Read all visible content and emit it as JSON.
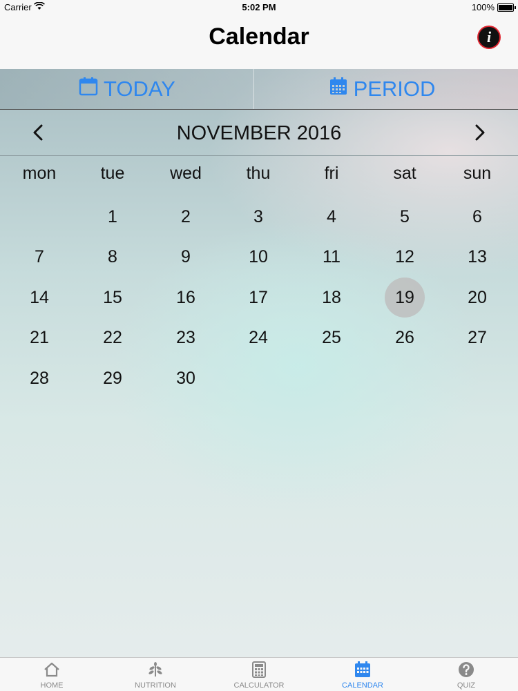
{
  "status_bar": {
    "carrier": "Carrier",
    "time": "5:02 PM",
    "battery": "100%"
  },
  "nav": {
    "title": "Calendar",
    "info_icon": "info-icon",
    "info_symbol": "i"
  },
  "segments": {
    "today": "TODAY",
    "period": "PERIOD",
    "icon": "calendar-icon"
  },
  "month": {
    "title": "NOVEMBER 2016",
    "prev_icon": "chevron-left-icon",
    "next_icon": "chevron-right-icon"
  },
  "weekdays": [
    "mon",
    "tue",
    "wed",
    "thu",
    "fri",
    "sat",
    "sun"
  ],
  "weeks": [
    [
      "",
      "1",
      "2",
      "3",
      "4",
      "5",
      "6"
    ],
    [
      "7",
      "8",
      "9",
      "10",
      "11",
      "12",
      "13"
    ],
    [
      "14",
      "15",
      "16",
      "17",
      "18",
      "19",
      "20"
    ],
    [
      "21",
      "22",
      "23",
      "24",
      "25",
      "26",
      "27"
    ],
    [
      "28",
      "29",
      "30",
      "",
      "",
      "",
      ""
    ]
  ],
  "today_date": "19",
  "colors": {
    "accent": "#2f87ee",
    "inactive": "#8a8a8a",
    "highlight": "#bebebe"
  },
  "tabs": [
    {
      "label": "HOME",
      "icon": "home-icon",
      "active": false
    },
    {
      "label": "NUTRITION",
      "icon": "plant-icon",
      "active": false
    },
    {
      "label": "CALCULATOR",
      "icon": "calculator-icon",
      "active": false
    },
    {
      "label": "CALENDAR",
      "icon": "calendar-icon",
      "active": true
    },
    {
      "label": "QUIZ",
      "icon": "question-icon",
      "active": false
    }
  ]
}
